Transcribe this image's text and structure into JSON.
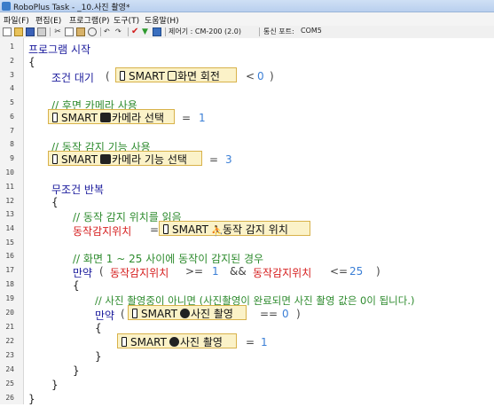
{
  "window": {
    "title": "RoboPlus Task - _10.사진 촬영*"
  },
  "menu": [
    {
      "label": "파일(F)"
    },
    {
      "label": "편집(E)"
    },
    {
      "label": "프로그램(P)"
    },
    {
      "label": "도구(T)"
    },
    {
      "label": "도움말(H)"
    }
  ],
  "toolbar": {
    "controller_label": "제어기 : CM-200 (2.0)",
    "port_label": "통신 포트:",
    "port_value": "COM5"
  },
  "gutter": [
    "1",
    "2",
    "3",
    "4",
    "5",
    "6",
    "7",
    "8",
    "9",
    "10",
    "11",
    "12",
    "13",
    "14",
    "15",
    "16",
    "17",
    "18",
    "19",
    "20",
    "21",
    "22",
    "23",
    "24",
    "25",
    "26"
  ],
  "code": {
    "l1": "프로그램 시작",
    "l2": "{",
    "l3_kw": "조건 대기",
    "l3_open": "(",
    "l3_smart": "SMART",
    "l3_label": "화면 회전",
    "l3_op": "<",
    "l3_val": "0",
    "l3_close": ")",
    "l5_comment": "// 후면 카메라 사용",
    "l6_smart": "SMART",
    "l6_label": "카메라 선택",
    "l6_op": "=",
    "l6_val": "1",
    "l8_comment": "// 동작 감지 기능 사용",
    "l9_smart": "SMART",
    "l9_label": "카메라 기능 선택",
    "l9_op": "=",
    "l9_val": "3",
    "l11_kw": "무조건 반복",
    "l12": "{",
    "l13_comment": "// 동작 감지 위치를 읽음",
    "l14_var": "동작감지위치",
    "l14_op": "=",
    "l14_smart": "SMART",
    "l14_label": "동작 감지 위치",
    "l16_comment": "// 화면 1 ~ 25 사이에 동작이 감지된 경우",
    "l17_kw": "만약",
    "l17_open": "(",
    "l17_var1": "동작감지위치",
    "l17_op1": ">=",
    "l17_val1": "1",
    "l17_and": "&&",
    "l17_var2": "동작감지위치",
    "l17_op2": "<=",
    "l17_val2": "25",
    "l17_close": ")",
    "l18": "{",
    "l19_comment": "// 사진 촬영중이 아니면 (사진촬영이 완료되면 사진 촬영 값은 0이 됩니다.)",
    "l20_kw": "만약",
    "l20_open": "(",
    "l20_smart": "SMART",
    "l20_label": "사진 촬영",
    "l20_op": "==",
    "l20_val": "0",
    "l20_close": ")",
    "l21": "{",
    "l22_smart": "SMART",
    "l22_label": "사진 촬영",
    "l22_op": "=",
    "l22_val": "1",
    "l23": "}",
    "l24": "}",
    "l25": "}",
    "l26": "}"
  }
}
